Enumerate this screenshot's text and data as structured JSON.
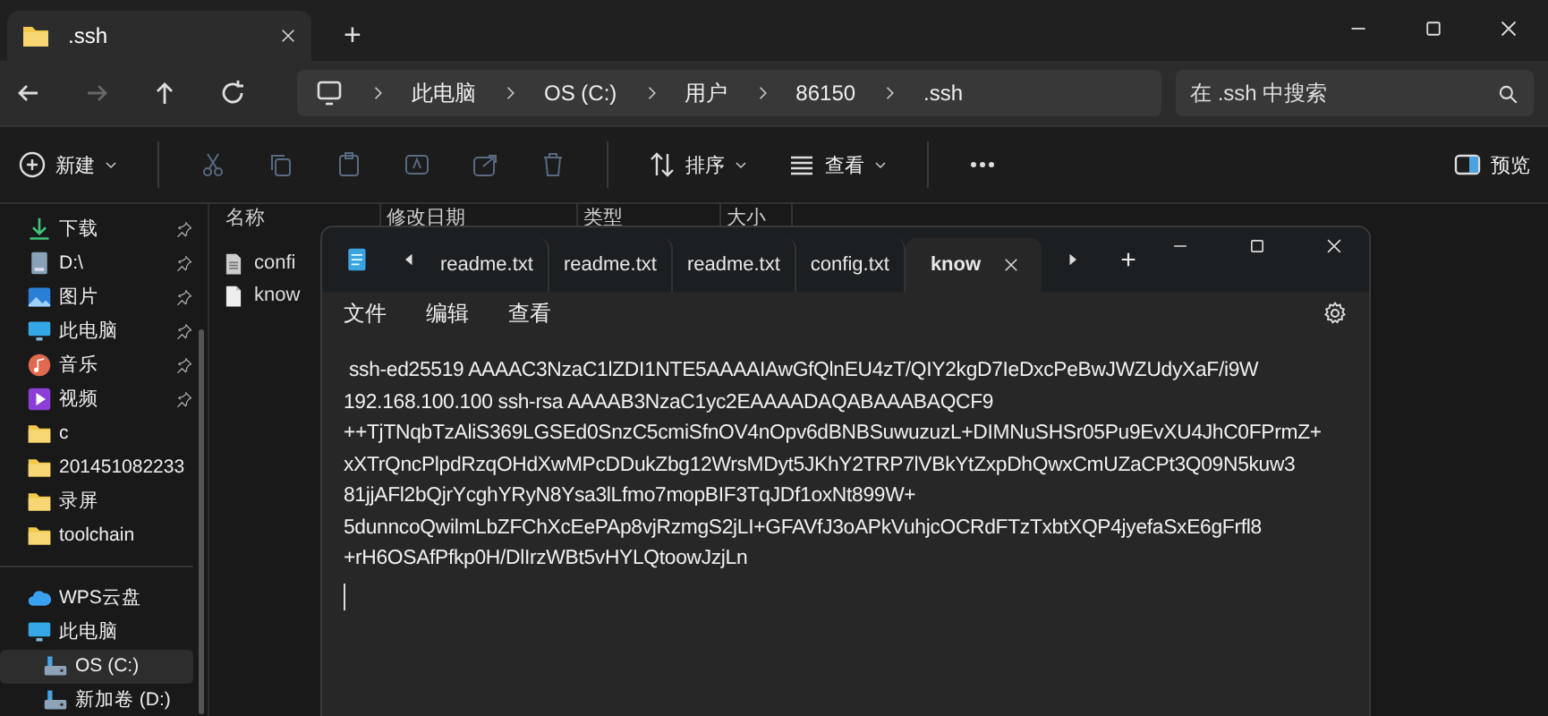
{
  "explorer": {
    "tabs": [
      {
        "title": ".ssh",
        "selected": true
      }
    ],
    "new_tab": "+",
    "breadcrumb": [
      "此电脑",
      "OS (C:)",
      "用户",
      "86150",
      ".ssh"
    ],
    "search": {
      "placeholder": "在 .ssh 中搜索"
    },
    "toolbar": {
      "new": "新建",
      "sort": "排序",
      "view": "查看",
      "preview": "预览"
    },
    "sidebar": {
      "quick_access": [
        {
          "label": "下载",
          "kind": "download",
          "pinned": true
        },
        {
          "label": "D:\\",
          "kind": "drive",
          "pinned": true
        },
        {
          "label": "图片",
          "kind": "pictures",
          "pinned": true
        },
        {
          "label": "此电脑",
          "kind": "pc",
          "pinned": true
        },
        {
          "label": "音乐",
          "kind": "music",
          "pinned": true
        },
        {
          "label": "视频",
          "kind": "video",
          "pinned": true
        },
        {
          "label": "c",
          "kind": "folder",
          "pinned": false
        },
        {
          "label": "201451082233",
          "kind": "folder",
          "pinned": false
        },
        {
          "label": "录屏",
          "kind": "folder",
          "pinned": false
        },
        {
          "label": "toolchain",
          "kind": "folder",
          "pinned": false
        }
      ],
      "locations": [
        {
          "label": "WPS云盘",
          "kind": "cloud",
          "selected": false
        },
        {
          "label": "此电脑",
          "kind": "pc",
          "selected": false,
          "children": [
            {
              "label": "OS (C:)",
              "kind": "disk",
              "selected": true
            },
            {
              "label": "新加卷 (D:)",
              "kind": "disk",
              "selected": false
            }
          ]
        }
      ]
    },
    "columns": [
      "名称",
      "修改日期",
      "类型",
      "大小"
    ],
    "files": [
      {
        "name": "confi",
        "kind": "config"
      },
      {
        "name": "know",
        "kind": "file"
      }
    ]
  },
  "notepad": {
    "tabs": [
      {
        "label": "readme.txt",
        "selected": false
      },
      {
        "label": "readme.txt",
        "selected": false
      },
      {
        "label": "readme.txt",
        "selected": false
      },
      {
        "label": "config.txt",
        "selected": false
      },
      {
        "label": "know",
        "selected": true
      }
    ],
    "new_tab": "+",
    "menu": [
      "文件",
      "编辑",
      "查看"
    ],
    "lines": [
      " ssh-ed25519 AAAAC3NzaC1lZDI1NTE5AAAAIAwGfQlnEU4zT/QIY2kgD7IeDxcPeBwJWZUdyXaF/i9W",
      "192.168.100.100 ssh-rsa AAAAB3NzaC1yc2EAAAADAQABAAABAQCF9",
      "++TjTNqbTzAliS369LGSEd0SnzC5cmiSfnOV4nOpv6dBNBSuwuzuzL+DIMNuSHSr05Pu9EvXU4JhC0FPrmZ+",
      "xXTrQncPlpdRzqOHdXwMPcDDukZbg12WrsMDyt5JKhY2TRP7lVBkYtZxpDhQwxCmUZaCPt3Q09N5kuw3",
      "81jjAFl2bQjrYcghYRyN8Ysa3lLfmo7mopBIF3TqJDf1oxNt899W+",
      "5dunncoQwilmLbZFChXcEePAp8vjRzmgS2jLI+GFAVfJ3oAPkVuhjcOCRdFTzTxbtXQP4jyefaSxE6gFrfl8",
      "+rH6OSAfPfkp0H/DlIrzWBt5vHYLQtoowJzjLn"
    ]
  }
}
